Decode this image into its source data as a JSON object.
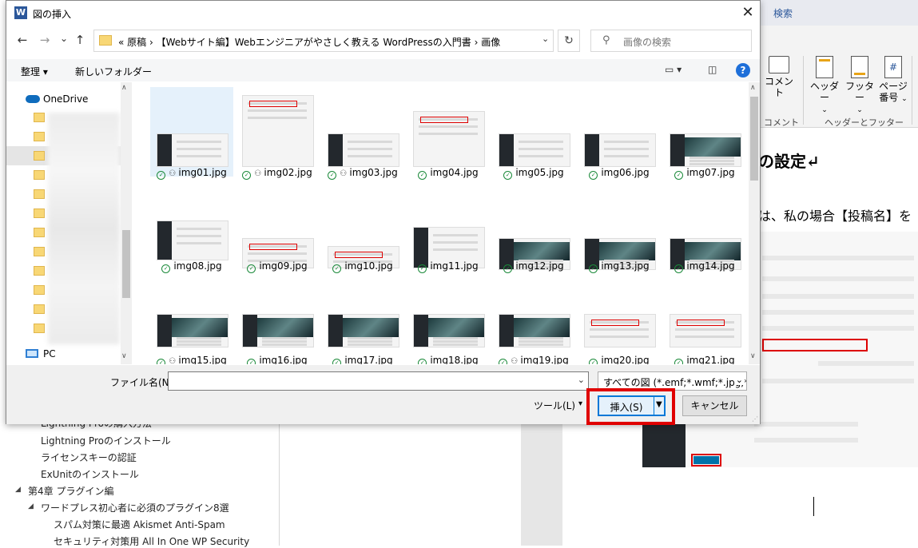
{
  "dialog": {
    "title": "図の挿入",
    "app_logo": "W",
    "nav": {
      "back": "←",
      "forward": "→",
      "recent": "⌄",
      "up": "↑"
    },
    "breadcrumb": "«  原稿  ›  【Webサイト編】Webエンジニアがやさしく教える WordPressの入門書  ›  画像",
    "search_placeholder": "画像の検索",
    "toolbar": {
      "organize": "整理 ▾",
      "new_folder": "新しいフォルダー"
    },
    "tree": {
      "onedrive": "OneDrive",
      "pc": "PC"
    },
    "files": [
      {
        "name": "img01.jpg",
        "selected": true
      },
      {
        "name": "img02.jpg",
        "selected": false
      },
      {
        "name": "img03.jpg",
        "selected": false
      },
      {
        "name": "img04.jpg",
        "selected": false
      },
      {
        "name": "img05.jpg",
        "selected": false
      },
      {
        "name": "img06.jpg",
        "selected": false
      },
      {
        "name": "img07.jpg",
        "selected": false
      },
      {
        "name": "img08.jpg",
        "selected": false
      },
      {
        "name": "img09.jpg",
        "selected": false
      },
      {
        "name": "img10.jpg",
        "selected": false
      },
      {
        "name": "img11.jpg",
        "selected": false
      },
      {
        "name": "img12.jpg",
        "selected": false
      },
      {
        "name": "img13.jpg",
        "selected": false
      },
      {
        "name": "img14.jpg",
        "selected": false
      },
      {
        "name": "img15.jpg",
        "selected": false
      },
      {
        "name": "img16.jpg",
        "selected": false
      },
      {
        "name": "img17.jpg",
        "selected": false
      },
      {
        "name": "img18.jpg",
        "selected": false
      },
      {
        "name": "img19.jpg",
        "selected": false
      },
      {
        "name": "img20.jpg",
        "selected": false
      },
      {
        "name": "img21.jpg",
        "selected": false
      }
    ],
    "filename_label": "ファイル名(N):",
    "filename_value": "",
    "filetype": "すべての図 (*.emf;*.wmf;*.jpg;*.jp",
    "tools_label": "ツール(L)",
    "insert_label": "挿入(S)",
    "cancel_label": "キャンセル",
    "highlight_color": "#e00000"
  },
  "word": {
    "search_tab": "検索",
    "ribbon": {
      "comment": "コメント",
      "comment_group": "コメント",
      "header": "ヘッダー",
      "footer": "フッター",
      "page_number": "ページ\n番号",
      "hf_group": "ヘッダーとフッター"
    },
    "doc_heading": "の設定↵",
    "doc_text": "は、私の場合【投稿名】を",
    "paragraph_mark": "↵"
  },
  "navigation": {
    "items": [
      {
        "label": "Lightning Proの購入方法",
        "indent": 2
      },
      {
        "label": "Lightning Proのインストール",
        "indent": 2
      },
      {
        "label": "ライセンスキーの認証",
        "indent": 2
      },
      {
        "label": "ExUnitのインストール",
        "indent": 2
      },
      {
        "label": "第4章 プラグイン編",
        "indent": 0
      },
      {
        "label": "ワードプレス初心者に必須のプラグイン8選",
        "indent": 1
      },
      {
        "label": "スパム対策に最適 Akismet Anti-Spam",
        "indent": 2
      },
      {
        "label": "セキュリティ対策用 All In One WP Security",
        "indent": 2
      }
    ]
  }
}
